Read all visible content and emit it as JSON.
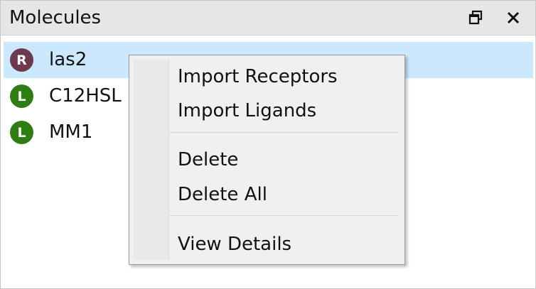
{
  "panel": {
    "title": "Molecules",
    "restore_icon": "restore-window-icon",
    "close_icon": "close-icon"
  },
  "molecules": [
    {
      "badge": "R",
      "name": "las2",
      "badge_color": "#6b3a4e",
      "selected": true
    },
    {
      "badge": "L",
      "name": "C12HSL",
      "badge_color": "#2e7d12",
      "selected": false
    },
    {
      "badge": "L",
      "name": "MM1",
      "badge_color": "#2e7d12",
      "selected": false
    }
  ],
  "context_menu": {
    "items": [
      "Import Receptors",
      "Import Ligands",
      "Delete",
      "Delete All",
      "View Details"
    ]
  },
  "colors": {
    "selection": "#cce8ff",
    "titlebar": "#e6e6e6",
    "menu_background": "#f0f0f0"
  }
}
